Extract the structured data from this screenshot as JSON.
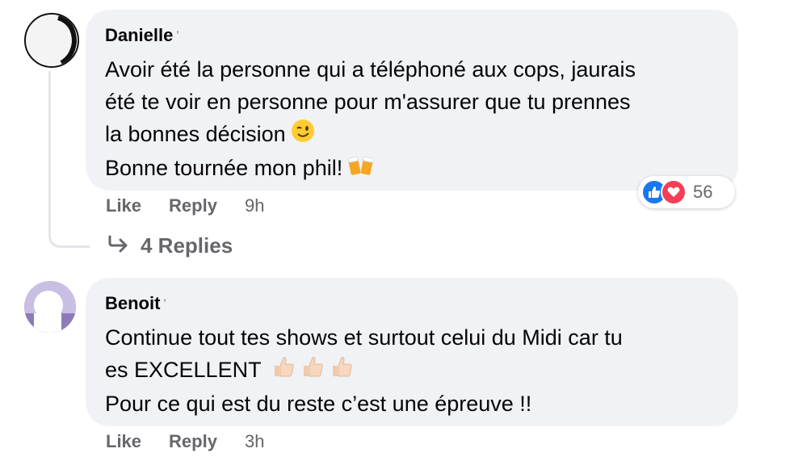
{
  "comments": [
    {
      "author": "Danielle",
      "tick": "ʼ",
      "lines": [
        "Avoir été la personne qui a téléphoné aux cops, jaurais",
        "été te voir en personne pour m'assurer que tu prennes",
        "la bonnes décision",
        "Bonne tournée mon phil!"
      ],
      "emojis": [
        "winking-face",
        "clinking-beer-mugs"
      ],
      "like_label": "Like",
      "reply_label": "Reply",
      "time": "9h",
      "reaction_count": "56",
      "reaction_icons": [
        "like",
        "love"
      ],
      "replies_label": "4 Replies"
    },
    {
      "author": "Benoit",
      "tick": "ʼ",
      "lines": [
        "Continue tout tes shows et surtout celui du Midi car tu",
        "es EXCELLENT",
        "Pour ce qui est du reste c’est une épreuve !!"
      ],
      "emojis": [
        "thumbs-up-light-skin",
        "thumbs-up-light-skin",
        "thumbs-up-light-skin"
      ],
      "like_label": "Like",
      "reply_label": "Reply",
      "time": "3h"
    }
  ],
  "colors": {
    "bubble": "#f0f2f5",
    "secondary_text": "#65676b",
    "like_blue": "#1877f2",
    "love_red": "#f33e58"
  }
}
